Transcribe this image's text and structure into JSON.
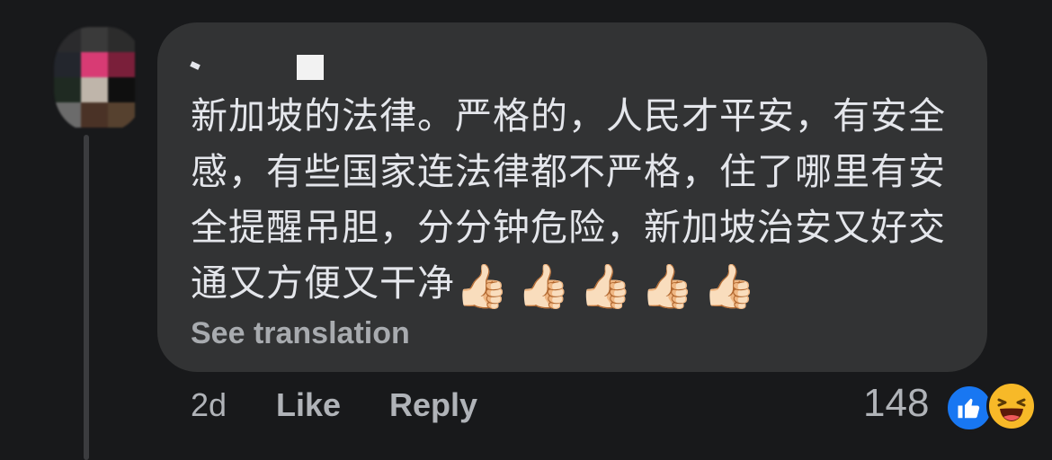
{
  "comment": {
    "text": "新加坡的法律。严格的，人民才平安，有安全感，有些国家连法律都不严格，住了哪里有安全提醒吊胆，分分钟危险，新加坡治安又好交通又方便又干净",
    "emojis": [
      "👍🏻",
      "👍🏻",
      "👍🏻",
      "👍🏻",
      "👍🏻"
    ],
    "see_translation": "See translation"
  },
  "actions": {
    "time": "2d",
    "like": "Like",
    "reply": "Reply"
  },
  "reactions": {
    "count": "148",
    "types": [
      "like-icon",
      "haha-icon"
    ]
  },
  "colors": {
    "background": "#18191b",
    "bubble": "#323334",
    "text": "#e4e6eb",
    "muted": "#b0b3b8",
    "like_blue": "#1877f2",
    "haha_yellow": "#f7b928"
  }
}
